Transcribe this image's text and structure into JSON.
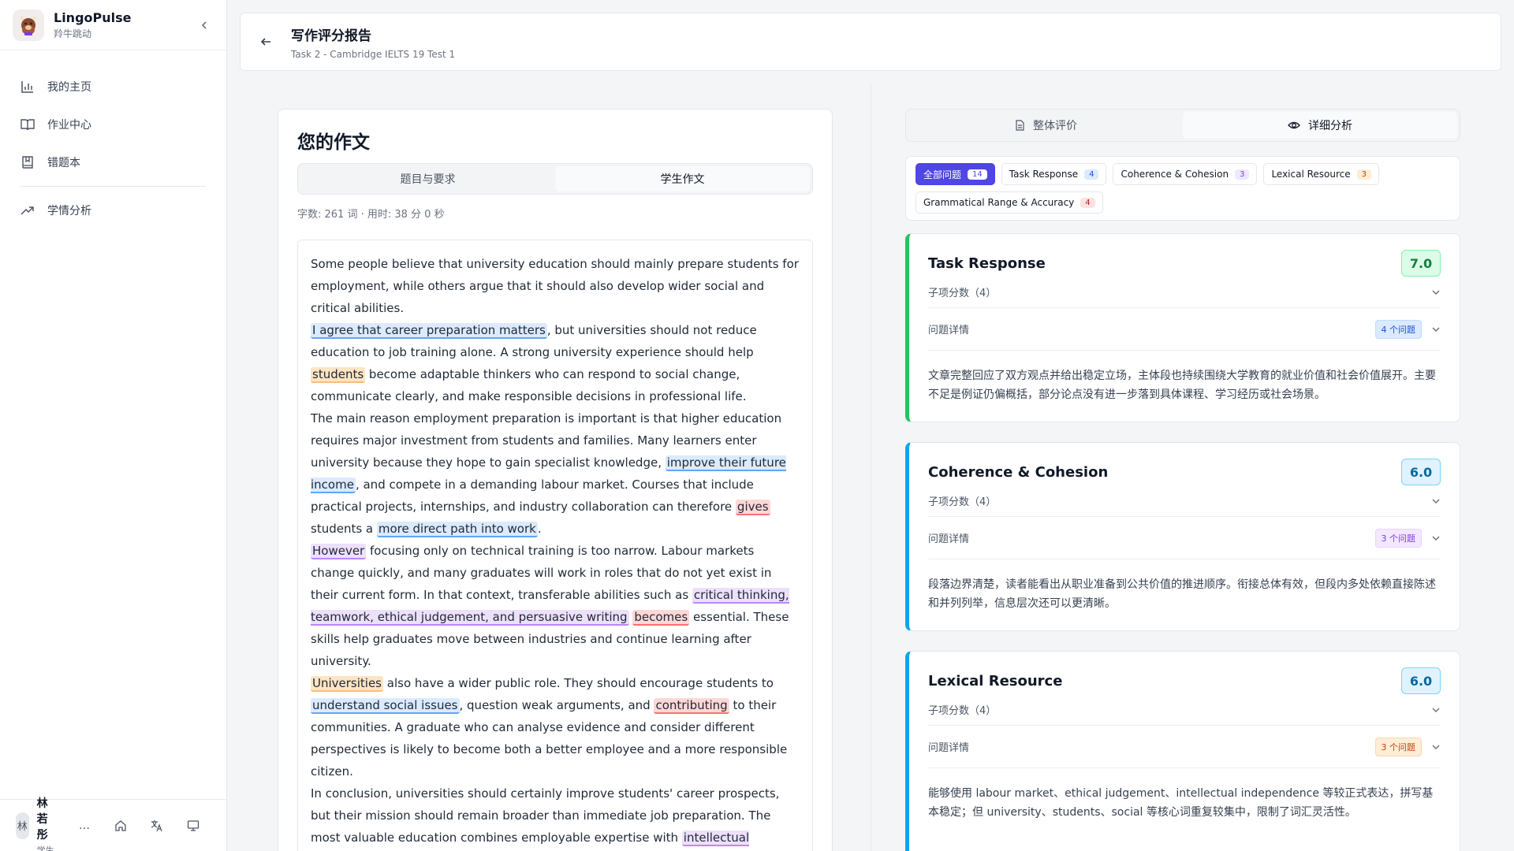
{
  "brand": {
    "title": "LingoPulse",
    "subtitle": "羚牛跳动"
  },
  "nav": [
    {
      "label": "我的主页",
      "icon": "bar-chart-icon"
    },
    {
      "label": "作业中心",
      "icon": "book-open-icon"
    },
    {
      "label": "错题本",
      "icon": "bookmark-book-icon"
    },
    {
      "label": "学情分析",
      "icon": "trending-up-icon"
    }
  ],
  "user": {
    "avatar": "林",
    "name": "林若彤",
    "role": "学生",
    "more": "…"
  },
  "header": {
    "title": "写作评分报告",
    "subtitle": "Task 2 - Cambridge IELTS 19 Test 1"
  },
  "essay": {
    "title": "您的作文",
    "tabs": [
      "题目与要求",
      "学生作文"
    ],
    "meta": "字数: 261 词 · 用时: 38 分 0 秒",
    "paragraphs": {
      "p1": "Some people believe that university education should mainly prepare students for employment, while others argue that it should also develop wider social and critical abilities.",
      "p2a": "I agree that career preparation matters",
      "p2b": ", but universities should not reduce education to job training alone. A strong university experience should help ",
      "p2c": "students",
      "p2d": " become adaptable thinkers who can respond to social change, communicate clearly, and make responsible decisions in professional life.",
      "p3a": "The main reason employment preparation is important is that higher education requires major investment from students and families. Many learners enter university because they hope to gain specialist knowledge, ",
      "p3b": "improve their future income",
      "p3c": ", and compete in a demanding labour market. Courses that include practical projects, internships, and industry collaboration can therefore ",
      "p3d": "gives",
      "p3e": " students a ",
      "p3f": "more direct path into work",
      "p3g": ".",
      "p4a": "However",
      "p4b": " focusing only on technical training is too narrow. Labour markets change quickly, and many graduates will work in roles that do not yet exist in their current form. In that context, transferable abilities such as ",
      "p4c": "critical thinking, teamwork, ethical judgement, and persuasive writing",
      "p4d": " ",
      "p4e": "becomes",
      "p4f": " essential. These skills help graduates move between industries and continue learning after university.",
      "p5a": "Universities",
      "p5b": " also have a wider public role. They should encourage students to ",
      "p5c": "understand social issues",
      "p5d": ", question weak arguments, and ",
      "p5e": "contributing",
      "p5f": " to their communities. A graduate who can analyse evidence and consider different perspectives is likely to become both a better employee and a more responsible citizen.",
      "p6a": "In conclusion, universities should certainly improve students' career prospects, but their mission should remain broader than immediate job preparation. The most valuable education combines employable expertise with ",
      "p6b": "intellectual independence and social awareness",
      "p6c": "."
    }
  },
  "right_tabs": [
    "整体评价",
    "详细分析"
  ],
  "filters": [
    {
      "label": "全部问题",
      "count": "14"
    },
    {
      "label": "Task Response",
      "count": "4"
    },
    {
      "label": "Coherence & Cohesion",
      "count": "3"
    },
    {
      "label": "Lexical Resource",
      "count": "3"
    },
    {
      "label": "Grammatical Range & Accuracy",
      "count": "4"
    }
  ],
  "criteria": [
    {
      "name": "Task Response",
      "score": "7.0",
      "sub_label": "子项分数（4）",
      "issues_label": "问题详情",
      "issues_badge": "4 个问题",
      "text": "文章完整回应了双方观点并给出稳定立场，主体段也持续围绕大学教育的就业价值和社会价值展开。主要不足是例证仍偏概括，部分论点没有进一步落到具体课程、学习经历或社会场景。"
    },
    {
      "name": "Coherence & Cohesion",
      "score": "6.0",
      "sub_label": "子项分数（4）",
      "issues_label": "问题详情",
      "issues_badge": "3 个问题",
      "text": "段落边界清楚，读者能看出从职业准备到公共价值的推进顺序。衔接总体有效，但段内多处依赖直接陈述和并列列举，信息层次还可以更清晰。"
    },
    {
      "name": "Lexical Resource",
      "score": "6.0",
      "sub_label": "子项分数（4）",
      "issues_label": "问题详情",
      "issues_badge": "3 个问题",
      "text": "能够使用 labour market、ethical judgement、intellectual independence 等较正式表达，拼写基本稳定；但 university、students、social 等核心词重复较集中，限制了词汇灵活性。"
    }
  ],
  "colors": {
    "accent": "#4f46e5",
    "green": "#22c55e",
    "blue": "#0ea5e9"
  }
}
